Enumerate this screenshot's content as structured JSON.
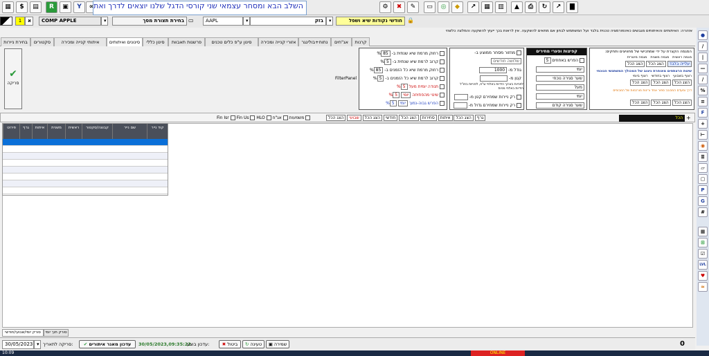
{
  "banner": {
    "text": "השלב הבא ומסחר עצמאי שני קורסי הדגל שלנו יוצאים לדרך ואתם מוזמנים לשיעור ראשון"
  },
  "toolbar": {
    "r_label": "R",
    "y_label": "Y"
  },
  "row2": {
    "scan_name": "חודשי נקודות שיא ושפל",
    "exchange": "בזק",
    "symbol": "AAPL",
    "layout_label": "בחירת תצורת מסך",
    "company": "COMP APPLE",
    "a_label": "א",
    "num": "1"
  },
  "note": "אזהרה: האיתותים והאיתותים מגבשים כאינפורמציה טכנית בלבד ועל המשתמש לבחון אם מתאים להשקעה. אין לראות בכך ייעוץ להשקעה והמלצה כלשהי",
  "tabs": [
    "קרנות",
    "אג\"חים",
    "נתוח+בולינגר",
    "אזורי קנייה ומכירה",
    "סינון ע\"פ כלים טכנים",
    "פרשנות תאבוות",
    "סינון כללי",
    "סינונים ואיתותים",
    "איתותי קנייה ומכירה",
    "סקטורים",
    "בחירת ניירות"
  ],
  "filter_panel": "FilterPanel",
  "scan_button": "סריקה",
  "group1": {
    "title_lines": [
      "המגמה הקצרת על ידי שמתכישי של מחוויצים ותחקים:"
    ],
    "labels": [
      "מגמה ראשית",
      "מגמה משנית",
      "מגמה מינורית"
    ],
    "selected": "עלייה בלבד",
    "show_all": "הצג הכל",
    "subtitle": "שיטת הרצתפים מאוחרת ניצוב של המכולך המשתנשי הנוכחי",
    "sub_labels": [
      "רצוף בשבועי",
      "רצוף בחודשי",
      "רצוף ביומי"
    ],
    "orange": "דרך ומעדם המכובב ספור אחד ורינות מורכמות של המבופים",
    "show_all_2": "הצג הכל"
  },
  "group2": {
    "title": "קפיצות ופערי מחירים",
    "items": [
      "הפרש באחוזים",
      "יומי",
      "שער סגירה נוכחי",
      "מעל",
      "יומי",
      "שער סגירה קודם"
    ],
    "value": "5"
  },
  "group3": {
    "items": [
      "מחזור מסחר ממוצע ב-",
      "שלושה חודשים",
      "גודל מ-",
      "קטן מ-",
      "רק ניירות שמחירם קטן מ-",
      "רק ניירות שמחירם גדול מ-"
    ],
    "value": "1000",
    "note": "לפנייות בארוך הידיות באלפי ש\"ח, לפנייות בחו\"ל הידיות באלפי מניות"
  },
  "group4": {
    "items": [
      "רחוק מרמת שיא שנתית ב-",
      "קרוב לרמת שיא שנתית ב-",
      "רחוק מרמת שיא כל הזמנים ב-",
      "קרוב לרמת שיא כל הזמנים ב-",
      "תנודה יומית מעל",
      "שינוי מהפתיחה",
      "הפרש גבוה-נמוך"
    ],
    "values": [
      "85",
      "5",
      "85",
      "5",
      "5",
      "5",
      "5"
    ],
    "pct": "%",
    "daily": "יומי",
    "red": "תנודה יומית מעל",
    "blue": "הפרש גבוה-נמוך"
  },
  "filterbar": {
    "items": [
      "Fin Isr",
      "Fin Us",
      "HLO",
      "משמעות",
      "אג\"ח",
      "הצג הכל",
      "הצג הכל",
      "שבועי",
      "הצג הכל",
      "חודשי",
      "הצג הכל",
      "סחירות",
      "איתות",
      "הצג הכל",
      "גרף",
      "הצג הכל"
    ],
    "active": "הכל"
  },
  "grid": {
    "columns": [
      "פירוט",
      "גרף",
      "איתות",
      "משנית",
      "ראשית",
      "קבוצה/סקטור",
      "שם נייר",
      "קוד נייר"
    ]
  },
  "bottom": {
    "date": "30/05/2023",
    "scan_until": "סריקה לתאריך:",
    "update_btn": "עדכון מאגר איתורים",
    "updated_label": "עדכון בוצע:",
    "updated_value": "30/05/2023,09:35:22",
    "cancel_btn": "ביטול",
    "load_btn": "טעינה",
    "save_btn": "שמירה",
    "count": "0",
    "tab1": "סורק יומי/שבועי/חודשי",
    "tab2": "סורק תוך יומי"
  },
  "taskbar": {
    "time": "10:09",
    "online": "ONLINE"
  }
}
